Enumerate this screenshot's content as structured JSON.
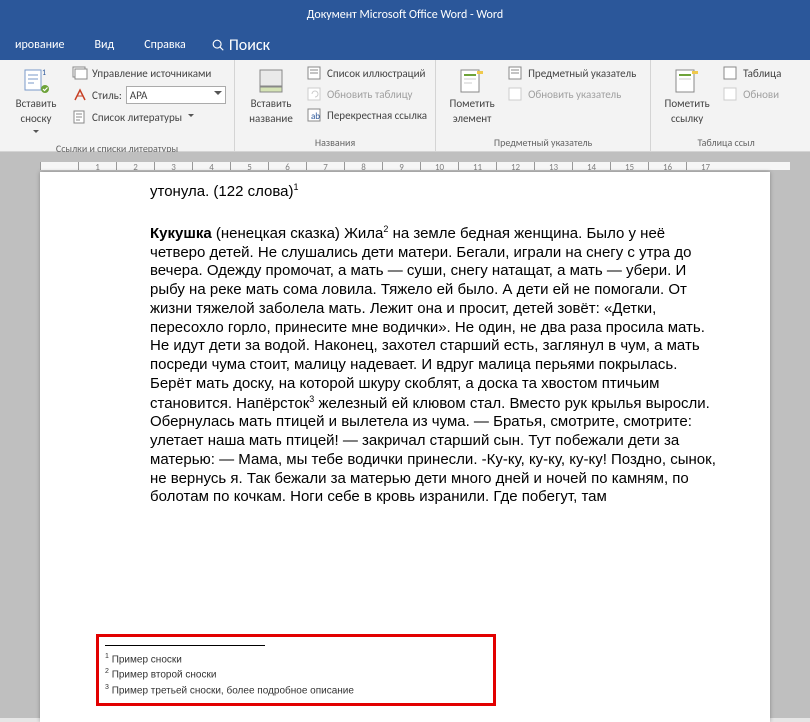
{
  "title": "Документ Microsoft Office Word  -  Word",
  "menu": {
    "item1": "ирование",
    "item2": "Вид",
    "item3": "Справка",
    "search": "Поиск"
  },
  "ribbon": {
    "insert_footnote": {
      "label1": "Вставить",
      "label2": "сноску"
    },
    "manage_sources": "Управление источниками",
    "style_label": "Стиль:",
    "style_value": "APA",
    "bibliography": "Список литературы",
    "group1_label": "Ссылки и списки литературы",
    "insert_caption": {
      "label1": "Вставить",
      "label2": "название"
    },
    "list_illustrations": "Список иллюстраций",
    "update_table": "Обновить таблицу",
    "cross_ref": "Перекрестная ссылка",
    "group2_label": "Названия",
    "mark_entry": {
      "label1": "Пометить",
      "label2": "элемент"
    },
    "subject_index": "Предметный указатель",
    "update_index": "Обновить указатель",
    "group3_label": "Предметный указатель",
    "mark_citation": {
      "label1": "Пометить",
      "label2": "ссылку"
    },
    "table_auth": "Таблица",
    "update_auth": "Обнови",
    "group4_label": "Таблица ссыл"
  },
  "ruler": [
    "",
    "1",
    "2",
    "3",
    "4",
    "5",
    "6",
    "7",
    "8",
    "9",
    "10",
    "11",
    "12",
    "13",
    "14",
    "15",
    "16",
    "17"
  ],
  "document": {
    "frag1_a": "утонула. (122 слова)",
    "title": "Кукушка",
    "body_a": " (ненецкая сказка) Жила",
    "body_b": " на земле бедная женщина. Было у неё четверо детей. Не слушались дети матери. Бегали, играли на снегу с утра до вечера. Одежду промочат, а мать — суши, снегу натащат, а мать — убери. И рыбу на реке мать сома ловила. Тяжело ей было. А дети ей не помогали. От жизни тяжелой заболела мать. Лежит она и просит, детей зовёт: «Детки, пересохло горло, принесите мне водички». Не один, не два раза просила мать. Не идут дети за водой. Наконец, захотел старший есть, заглянул в чум, а мать посреди чума стоит, малицу надевает. И вдруг малица перьями покрылась. Берёт мать доску, на которой шкуру скоблят, а доска та хвостом птичьим становится. Напёрсток",
    "body_c": " железный ей клювом стал. Вместо рук крылья выросли. Обернулась мать птицей и вылетела из чума. — Братья, смотрите, смотрите: улетает наша мать птицей! — закричал старший сын. Тут побежали дети за матерью: — Мама, мы тебе водички принесли. -Ку-ку, ку-ку, ку-ку! Поздно, сынок, не вернусь я. Так бежали за матерью дети много дней и ночей по камням, по болотам по кочкам. Ноги себе в кровь изранили. Где побегут, там",
    "fn1": "Пример сноски",
    "fn2": "Пример второй сноски",
    "fn3": "Пример третьей сноски, более подробное описание"
  }
}
